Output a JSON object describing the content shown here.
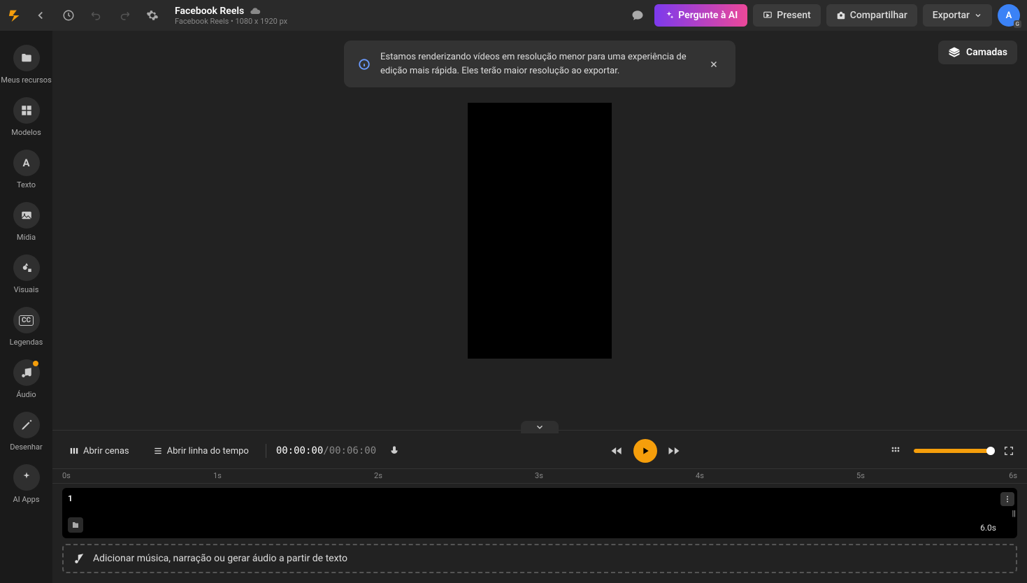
{
  "header": {
    "title": "Facebook Reels",
    "subtitle": "Facebook Reels • 1080 x 1920 px",
    "ask_ai": "Pergunte à AI",
    "present": "Present",
    "share": "Compartilhar",
    "export": "Exportar",
    "avatar_letter": "A",
    "avatar_badge": "G"
  },
  "sidebar": {
    "items": [
      {
        "label": "Meus recursos"
      },
      {
        "label": "Modelos"
      },
      {
        "label": "Texto"
      },
      {
        "label": "Mídia"
      },
      {
        "label": "Visuais"
      },
      {
        "label": "Legendas"
      },
      {
        "label": "Áudio"
      },
      {
        "label": "Desenhar"
      },
      {
        "label": "AI Apps"
      }
    ]
  },
  "toast": {
    "text": "Estamos renderizando vídeos em resolução menor para uma experiência de edição mais rápida. Eles terão maior resolução ao exportar."
  },
  "layers_label": "Camadas",
  "timeline": {
    "open_scenes": "Abrir cenas",
    "open_timeline": "Abrir linha do tempo",
    "current_time": "00:00:00",
    "duration": "00:06:00",
    "ruler": [
      "0s",
      "1s",
      "2s",
      "3s",
      "4s",
      "5s",
      "6s"
    ],
    "clip": {
      "number": "1",
      "duration": "6.0s"
    },
    "audio_prompt": "Adicionar música, narração ou gerar áudio a partir de texto"
  }
}
